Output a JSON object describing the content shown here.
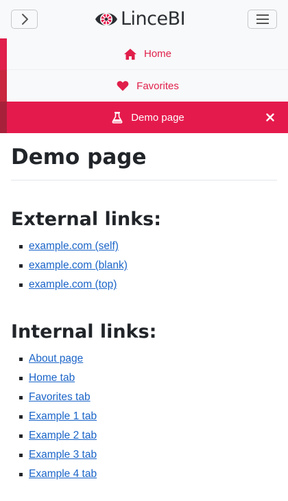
{
  "header": {
    "brand": "LinceBI",
    "left_button_icon": "chevron-right-icon",
    "right_button_icon": "hamburger-menu-icon"
  },
  "nav": {
    "items": [
      {
        "label": "Home",
        "icon": "home-icon"
      },
      {
        "label": "Favorites",
        "icon": "heart-icon"
      },
      {
        "label": "Demo page",
        "icon": "flask-icon",
        "active": true
      }
    ],
    "close_icon": "close-icon"
  },
  "colors": {
    "accent": "#e51a4c",
    "link": "#1a64c8",
    "header_bg": "#f8f9fa"
  },
  "page": {
    "title": "Demo page",
    "external": {
      "heading": "External links:",
      "links": [
        "example.com (self)",
        "example.com (blank)",
        "example.com (top)"
      ]
    },
    "internal": {
      "heading": "Internal links:",
      "links": [
        "About page",
        "Home tab",
        "Favorites tab",
        "Example 1 tab",
        "Example 2 tab",
        "Example 3 tab",
        "Example 4 tab"
      ]
    }
  }
}
